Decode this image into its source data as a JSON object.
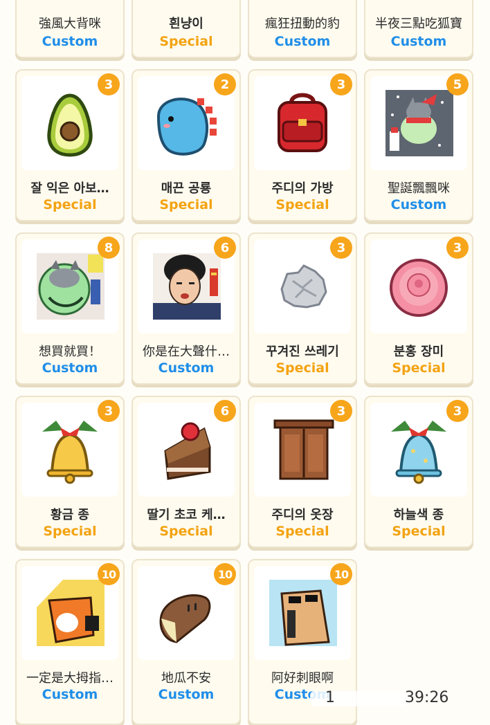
{
  "colors": {
    "custom": "#1f8ee8",
    "special": "#f3a312",
    "badge": "#f7a51b"
  },
  "rows": [
    [
      {
        "name": "強風大背咪",
        "type": "Custom"
      },
      {
        "name": "흰냥이",
        "type": "Special"
      },
      {
        "name": "瘋狂扭動的豹",
        "type": "Custom"
      },
      {
        "name": "半夜三點吃狐寶",
        "type": "Custom"
      }
    ],
    [
      {
        "name": "잘 익은 아보…",
        "type": "Special",
        "count": "3",
        "icon": "avocado-icon"
      },
      {
        "name": "매끈 공룡",
        "type": "Special",
        "count": "2",
        "icon": "dinosaur-icon"
      },
      {
        "name": "주디의 가방",
        "type": "Special",
        "count": "3",
        "icon": "backpack-icon"
      },
      {
        "name": "聖誕飄飄咪",
        "type": "Custom",
        "count": "5",
        "icon": "christmas-cat-icon"
      }
    ],
    [
      {
        "name": "想買就買！",
        "type": "Custom",
        "count": "8",
        "icon": "green-cat-icon"
      },
      {
        "name": "你是在大聲什…",
        "type": "Custom",
        "count": "6",
        "icon": "shouting-man-icon"
      },
      {
        "name": "꾸겨진 쓰레기",
        "type": "Special",
        "count": "3",
        "icon": "crumpled-paper-icon"
      },
      {
        "name": "분홍 장미",
        "type": "Special",
        "count": "3",
        "icon": "pink-rose-icon"
      }
    ],
    [
      {
        "name": "황금 종",
        "type": "Special",
        "count": "3",
        "icon": "golden-bell-icon"
      },
      {
        "name": "딸기 초코 케…",
        "type": "Special",
        "count": "6",
        "icon": "strawberry-cake-icon"
      },
      {
        "name": "주디의 옷장",
        "type": "Special",
        "count": "3",
        "icon": "wardrobe-icon"
      },
      {
        "name": "하늘색 종",
        "type": "Special",
        "count": "3",
        "icon": "sky-bell-icon"
      }
    ],
    [
      {
        "name": "一定是大拇指…",
        "type": "Custom",
        "count": "10",
        "icon": "thumb-fox-icon"
      },
      {
        "name": "地瓜不安",
        "type": "Custom",
        "count": "10",
        "icon": "sweet-potato-icon"
      },
      {
        "name": "阿好刺眼啊",
        "type": "Custom",
        "count": "10",
        "icon": "sunglasses-icon"
      }
    ]
  ],
  "status": {
    "page": "1",
    "time": "39:26"
  }
}
